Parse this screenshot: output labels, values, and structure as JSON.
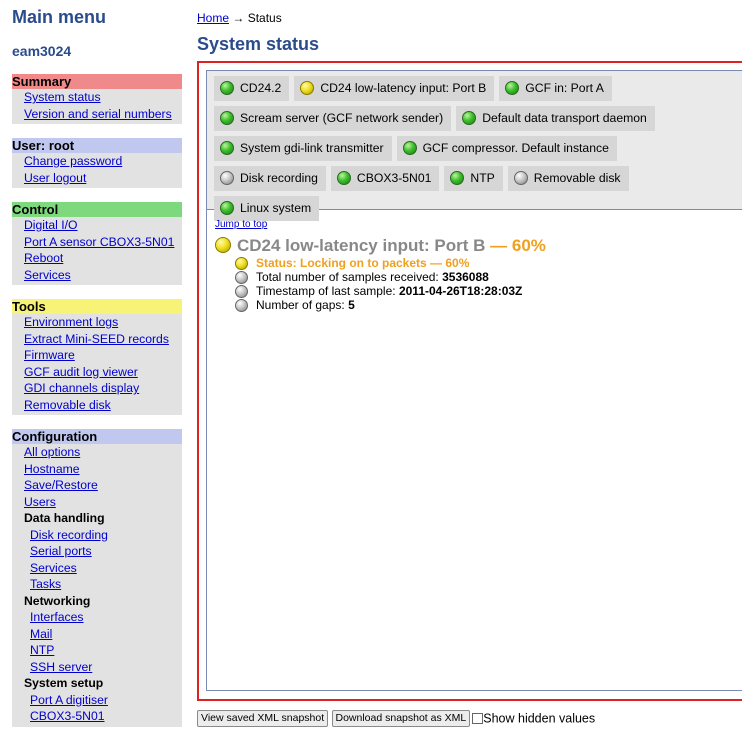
{
  "sidebar": {
    "title": "Main menu",
    "host": "eam3024",
    "sections": {
      "summary": {
        "heading": "Summary",
        "items": [
          "System status",
          "Version and serial numbers"
        ]
      },
      "user": {
        "heading": "User: root",
        "items": [
          "Change password",
          "User logout"
        ]
      },
      "control": {
        "heading": "Control",
        "items": [
          "Digital I/O",
          "Port A sensor CBOX3-5N01",
          "Reboot",
          "Services"
        ]
      },
      "tools": {
        "heading": "Tools",
        "items": [
          "Environment logs",
          "Extract Mini-SEED records",
          "Firmware",
          "GCF audit log viewer",
          "GDI channels display",
          "Removable disk"
        ]
      },
      "configuration": {
        "heading": "Configuration",
        "items": [
          "All options",
          "Hostname",
          "Save/Restore",
          "Users"
        ],
        "data_handling": {
          "label": "Data handling",
          "items": [
            "Disk recording",
            "Serial ports",
            "Services",
            "Tasks"
          ]
        },
        "networking": {
          "label": "Networking",
          "items": [
            "Interfaces",
            "Mail",
            "NTP",
            "SSH server"
          ]
        },
        "system_setup": {
          "label": "System setup",
          "items": [
            "Port A digitiser",
            "CBOX3-5N01"
          ]
        }
      }
    }
  },
  "breadcrumb": {
    "home": "Home",
    "separator": "→",
    "current": "Status"
  },
  "page_title": "System status",
  "tabs": [
    {
      "label": "CD24.2",
      "status": "green"
    },
    {
      "label": "CD24 low-latency input: Port B",
      "status": "yellow"
    },
    {
      "label": "GCF in: Port A",
      "status": "green"
    },
    {
      "label": "Scream server (GCF network sender)",
      "status": "green"
    },
    {
      "label": "Default data transport daemon",
      "status": "green"
    },
    {
      "label": "System gdi-link transmitter",
      "status": "green"
    },
    {
      "label": "GCF compressor. Default instance",
      "status": "green"
    },
    {
      "label": "Disk recording",
      "status": "grey"
    },
    {
      "label": "CBOX3-5N01",
      "status": "green"
    },
    {
      "label": "NTP",
      "status": "green"
    },
    {
      "label": "Removable disk",
      "status": "grey"
    },
    {
      "label": "Linux system",
      "status": "green"
    }
  ],
  "detail": {
    "jump": "Jump to top",
    "title": "CD24 low-latency input: Port B",
    "dash": "—",
    "percent": "60%",
    "status_label": "Status: Locking on to packets — 60%",
    "rows": [
      {
        "label": "Total number of samples received:",
        "value": "3536088"
      },
      {
        "label": "Timestamp of last sample:",
        "value": "2011-04-26T18:28:03Z"
      },
      {
        "label": "Number of gaps:",
        "value": "5"
      }
    ]
  },
  "footer": {
    "view_button": "View saved XML snapshot",
    "download_button": "Download snapshot as XML",
    "checkbox_label": "Show hidden values",
    "checkbox_checked": false
  },
  "colors": {
    "heading_blue": "#2b4c8c",
    "frame_red": "#dd2222",
    "status_orange": "#f0a020",
    "summary_header": "#f08a8a",
    "user_header": "#c0c8f0",
    "control_header": "#7ed87e",
    "tools_header": "#f7f377",
    "configuration_header": "#c0c8f0"
  }
}
